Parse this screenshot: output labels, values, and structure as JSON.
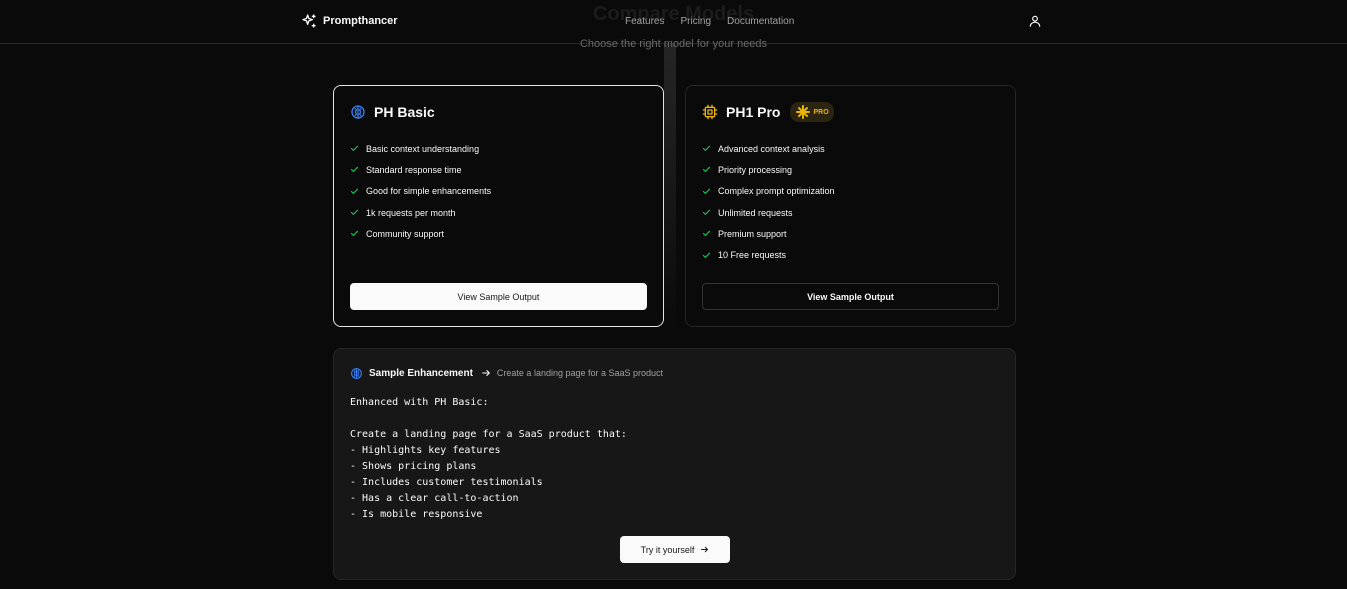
{
  "header": {
    "brand": "Prompthancer",
    "nav": [
      "Features",
      "Pricing",
      "Documentation"
    ],
    "section_title": "Compare Models",
    "section_subtitle": "Choose the right model for your needs"
  },
  "cards": {
    "basic": {
      "title": "PH Basic",
      "features": [
        "Basic context understanding",
        "Standard response time",
        "Good for simple enhancements",
        "1k requests per month",
        "Community support"
      ],
      "button": "View Sample Output",
      "icon": "brain-icon",
      "accent": "#3b82f6"
    },
    "pro": {
      "title": "PH1 Pro",
      "badge": "PRO",
      "features": [
        "Advanced context analysis",
        "Priority processing",
        "Complex prompt optimization",
        "Unlimited requests",
        "Premium support",
        "10 Free requests"
      ],
      "button": "View Sample Output",
      "icon": "cpu-icon",
      "accent": "#eab308"
    }
  },
  "sample": {
    "label": "Sample Enhancement",
    "prompt": "Create a landing page for a SaaS product",
    "output": "Enhanced with PH Basic:\n\nCreate a landing page for a SaaS product that:\n- Highlights key features\n- Shows pricing plans\n- Includes customer testimonials\n- Has a clear call-to-action\n- Is mobile responsive",
    "button": "Try it yourself"
  },
  "colors": {
    "background": "#0a0a0a",
    "check": "#22c55e",
    "border": "#262626"
  }
}
